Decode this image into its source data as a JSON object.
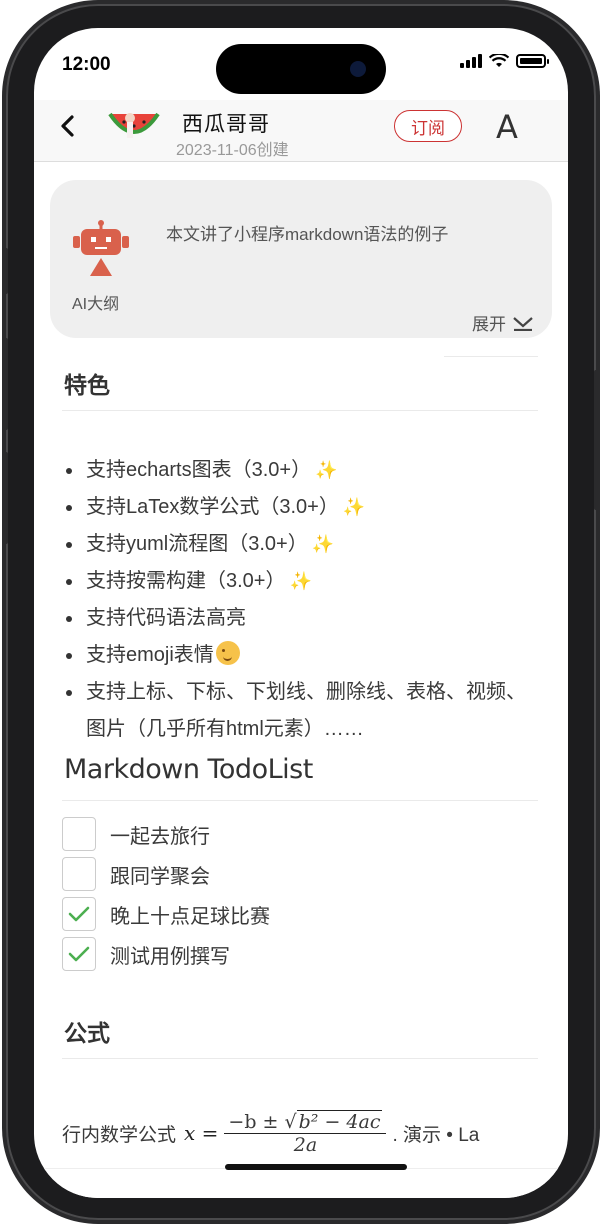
{
  "status_bar": {
    "time": "12:00"
  },
  "header": {
    "author_name": "西瓜哥哥",
    "created_date": "2023-11-06创建",
    "subscribe_label": "订阅",
    "font_button_label": "A"
  },
  "ai_outline": {
    "label": "AI大纲",
    "summary": "本文讲了小程序markdown语法的例子",
    "expand_label": "展开"
  },
  "sections": {
    "features_title": "特色",
    "todo_title": "Markdown TodoList",
    "formula_title": "公式"
  },
  "features": [
    {
      "text": "支持echarts图表（3.0+）",
      "sparkle": "✨"
    },
    {
      "text": "支持LaTex数学公式（3.0+）",
      "sparkle": "✨"
    },
    {
      "text": "支持yuml流程图（3.0+）",
      "sparkle": "✨"
    },
    {
      "text": "支持按需构建（3.0+）",
      "sparkle": "✨"
    },
    {
      "text": "支持代码语法高亮",
      "sparkle": ""
    },
    {
      "text": "支持emoji表情",
      "sparkle": ""
    },
    {
      "text": "支持上标、下标、下划线、删除线、表格、视频、图片（几乎所有html元素）……",
      "sparkle": ""
    }
  ],
  "todos": [
    {
      "label": "一起去旅行",
      "checked": false
    },
    {
      "label": "跟同学聚会",
      "checked": false
    },
    {
      "label": "晚上十点足球比赛",
      "checked": true
    },
    {
      "label": "测试用例撰写",
      "checked": true
    }
  ],
  "formula": {
    "prefix": "行内数学公式",
    "lhs": "x =",
    "numerator_a": "−b ± ",
    "sqrt_content": "b² − 4ac",
    "denominator": "2a",
    "suffix": ". 演示 • La"
  },
  "colors": {
    "accent_red": "#cc3333",
    "check_green": "#4caf50",
    "card_bg": "#efefef"
  }
}
